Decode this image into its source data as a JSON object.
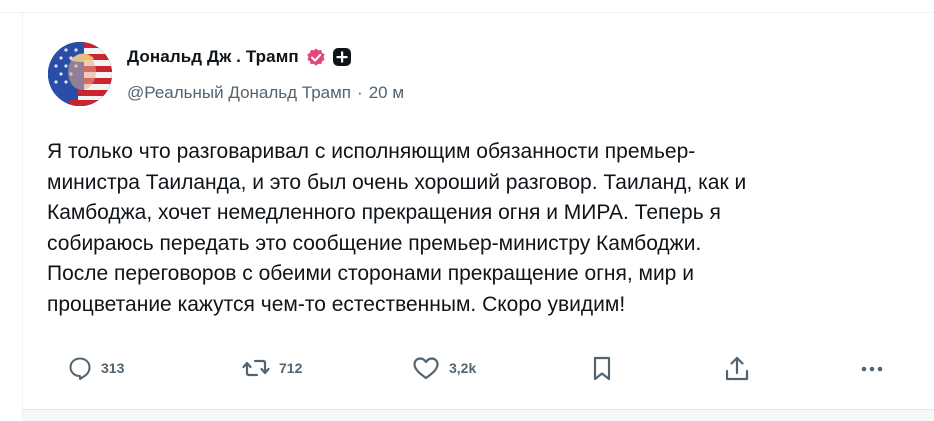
{
  "post": {
    "author_name": "Дональд Дж . Трамп",
    "handle": "@Реальный Дональд Трамп",
    "separator": "·",
    "time": "20 м",
    "text": "Я только что разговаривал с исполняющим обязанности премьер-\nминистра Таиланда, и это был очень хороший разговор. Таиланд, как и\nКамбоджа, хочет немедленного прекращения огня и МИРА. Теперь я\nсобираюсь передать это сообщение премьер-министру Камбоджи.\nПосле переговоров с обеими сторонами прекращение огня, мир и\nпроцветание кажутся чем-то естественным. Скоро увидим!"
  },
  "actions": {
    "reply_count": "313",
    "repost_count": "712",
    "like_count": "3,2k"
  },
  "icons": {
    "verified": "verified-badge-icon",
    "plus": "plus-badge-icon",
    "reply": "reply-icon",
    "repost": "repost-icon",
    "like": "heart-icon",
    "bookmark": "bookmark-icon",
    "share": "share-icon",
    "more": "more-icon"
  },
  "colors": {
    "text": "#0f1419",
    "secondary": "#536471",
    "verified": "#e0487c",
    "divider": "#eff3f4"
  }
}
